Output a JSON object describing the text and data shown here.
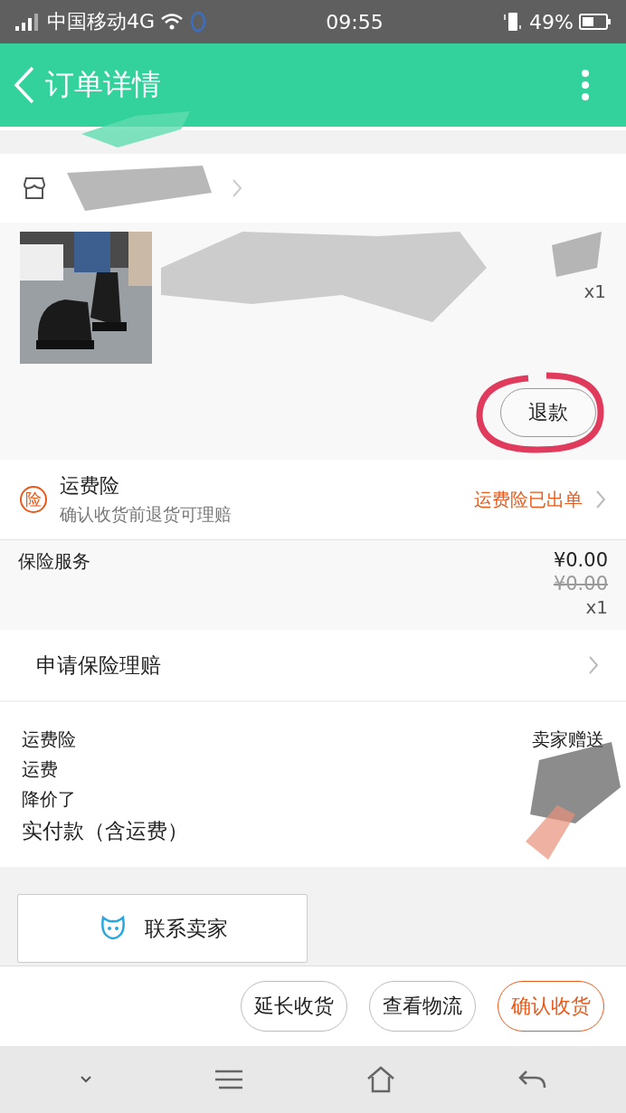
{
  "status_bar": {
    "carrier": "中国移动4G",
    "time": "09:55",
    "battery": "49%"
  },
  "header": {
    "title": "订单详情"
  },
  "product": {
    "quantity": "x1",
    "refund_button": "退款",
    "refund_highlighted": true
  },
  "freight_insurance": {
    "badge": "险",
    "title": "运费险",
    "subtitle": "确认收货前退货可理赔",
    "status": "运费险已出单"
  },
  "insurance_service": {
    "name": "保险服务",
    "price": "¥0.00",
    "original_price": "¥0.00",
    "quantity": "x1"
  },
  "claim": {
    "label": "申请保险理赔"
  },
  "summary": {
    "rows": [
      {
        "label": "运费险",
        "value": "卖家赠送",
        "kind": "normal"
      },
      {
        "label": "运费",
        "kind": "normal"
      },
      {
        "label": "降价了",
        "kind": "normal"
      },
      {
        "label": "实付款（含运费）",
        "kind": "total"
      }
    ]
  },
  "contact_seller": "联系卖家",
  "actions": [
    {
      "label": "延长收货",
      "primary": false
    },
    {
      "label": "查看物流",
      "primary": false
    },
    {
      "label": "确认收货",
      "primary": true
    }
  ]
}
